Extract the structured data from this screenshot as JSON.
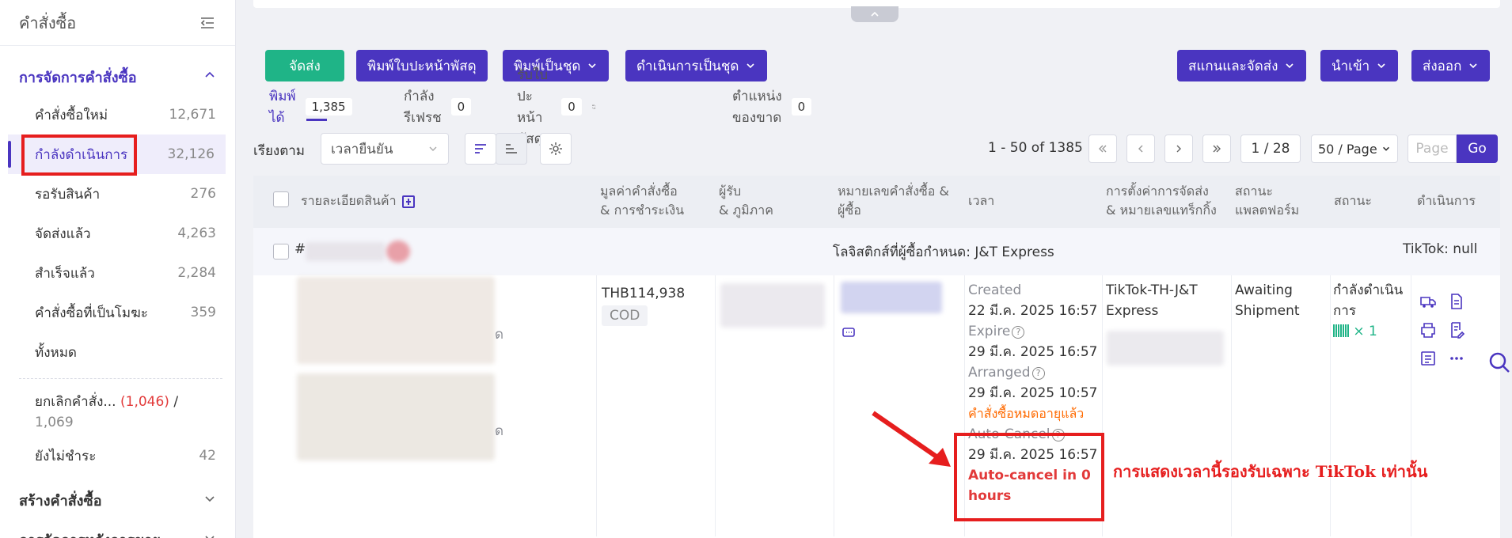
{
  "sidebar": {
    "title": "คำสั่งซื้อ",
    "section_order_mgmt": "การจัดการคำสั่งซื้อ",
    "items": [
      {
        "label": "คำสั่งซื้อใหม่",
        "count": "12,671"
      },
      {
        "label": "กำลังดำเนินการ",
        "count": "32,126"
      },
      {
        "label": "รอรับสินค้า",
        "count": "276"
      },
      {
        "label": "จัดส่งแล้ว",
        "count": "4,263"
      },
      {
        "label": "สำเร็จแล้ว",
        "count": "2,284"
      },
      {
        "label": "คำสั่งซื้อที่เป็นโมฆะ",
        "count": "359"
      },
      {
        "label": "ทั้งหมด",
        "count": ""
      }
    ],
    "cancel_item": {
      "label": "ยกเลิกคำสั่ง...",
      "count_red": "(1,046)",
      "sep": "/",
      "count_total": "1,069"
    },
    "unpaid_item": {
      "label": "ยังไม่ชำระ",
      "count": "42"
    },
    "section_create": "สร้างคำสั่งซื้อ",
    "section_after_sales": "การจัดการหลังการขาย"
  },
  "actions": {
    "ship": "จัดส่ง",
    "print_label": "พิมพ์ใบปะหน้าพัสดุ",
    "print_batch": "พิมพ์เป็นชุด",
    "process_batch": "ดำเนินการเป็นชุด",
    "scan_ship": "สแกนและจัดส่ง",
    "import": "นำเข้า",
    "export": "ส่งออก"
  },
  "tabs": [
    {
      "label": "พิมพ์ได้",
      "count": "1,385"
    },
    {
      "label": "กำลังรีเฟรช",
      "count": "0"
    },
    {
      "label": "รับใบปะหน้าพัสดุ",
      "count": "0"
    },
    {
      "label": "ตำแหน่งของขาด",
      "count": "0"
    }
  ],
  "toolbar": {
    "sort_label": "เรียงตาม",
    "sort_value": "เวลายืนยัน",
    "range": "1 - 50 of 1385",
    "page_current": "1 / 28",
    "page_size": "50 / Page",
    "page_placeholder": "Page",
    "go": "Go"
  },
  "table": {
    "headers": {
      "product": "รายละเอียดสินค้า",
      "value_1": "มูลค่าคำสั่งซื้อ",
      "value_2": "& การชำระเงิน",
      "receiver_1": "ผู้รับ",
      "receiver_2": "& ภูมิภาค",
      "order_no_1": "หมายเลขคำสั่งซื้อ &",
      "order_no_2": "ผู้ซื้อ",
      "time": "เวลา",
      "shipping_1": "การตั้งค่าการจัดส่ง",
      "shipping_2": "& หมายเลขแทร็กกิ้ง",
      "platform_1": "สถานะ",
      "platform_2": "แพลตฟอร์ม",
      "status": "สถานะ",
      "action": "ดำเนินการ"
    },
    "order": {
      "hash": "#",
      "logistics": "โลจิสติกส์ที่ผู้ซื้อกำหนด: J&T Express",
      "platform_tag": "TikTok: null",
      "amount": "THB114,938",
      "payment": "COD",
      "created_label": "Created",
      "created_value": "22 มี.ค. 2025 16:57",
      "expire_label": "Expire",
      "expire_value": "29 มี.ค. 2025 16:57",
      "arranged_label": "Arranged",
      "arranged_value": "29 มี.ค. 2025 10:57",
      "expired_note": "คำสั่งซื้อหมดอายุแล้ว",
      "autocancel_label": "Auto-Cancel",
      "autocancel_value": "29 มี.ค. 2025 16:57",
      "autocancel_note_1": "Auto-cancel in 0",
      "autocancel_note_2": "hours",
      "shipping_setting_1": "TikTok-TH-J&T",
      "shipping_setting_2": "Express",
      "platform_status_1": "Awaiting",
      "platform_status_2": "Shipment",
      "status_1": "กำลังดำเนิน",
      "status_2": "การ",
      "barcode_count": "× 1",
      "partial_text": "ด"
    }
  },
  "annotation": "การแสดงเวลานี้รองรับเฉพาะ TikTok เท่านั้น",
  "colors": {
    "brand_purple": "#4a35c0",
    "green": "#1fb487",
    "highlight_red": "#e61e1e",
    "warning_orange": "#ff6a00"
  }
}
